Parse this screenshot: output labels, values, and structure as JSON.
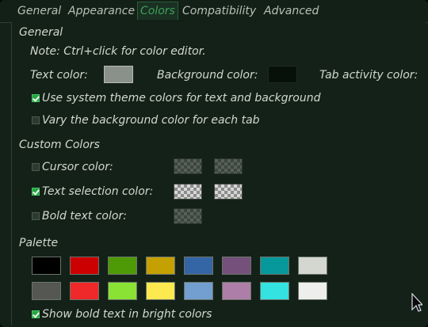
{
  "tabs": [
    "General",
    "Appearance",
    "Colors",
    "Compatibility",
    "Advanced"
  ],
  "general": {
    "title": "General",
    "note": "Note: Ctrl+click for color editor.",
    "text_color_label": "Text color:",
    "background_color_label": "Background color:",
    "tab_activity_color_label": "Tab activity color:",
    "use_system_theme_label": "Use system theme colors for text and background",
    "vary_background_label": "Vary the background color for each tab",
    "text_color_value": "#8a918a",
    "background_color_value": "#07110a"
  },
  "custom_colors": {
    "title": "Custom Colors",
    "cursor_color_label": "Cursor color:",
    "text_selection_color_label": "Text selection color:",
    "bold_text_color_label": "Bold text color:"
  },
  "palette": {
    "title": "Palette",
    "row1": [
      "#000000",
      "#cc0000",
      "#4e9a06",
      "#c4a000",
      "#3465a4",
      "#75507b",
      "#06989a",
      "#d3d7cf"
    ],
    "row2": [
      "#555753",
      "#ef2929",
      "#8ae234",
      "#fce94f",
      "#729fcf",
      "#ad7fa8",
      "#34e2e2",
      "#eeeeec"
    ],
    "show_bold_bright_label": "Show bold text in bright colors"
  },
  "icons": {
    "checkbox_checked": "checkbox-checked-icon",
    "checkbox_unchecked": "checkbox-unchecked-icon",
    "mouse_cursor": "mouse-cursor-icon"
  }
}
